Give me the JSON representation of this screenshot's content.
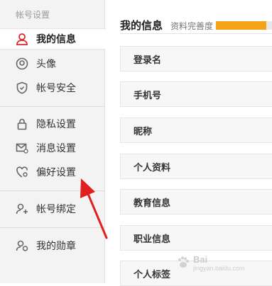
{
  "sidebar": {
    "section_title": "帐号设置",
    "items": [
      {
        "label": "我的信息",
        "icon": "user-icon",
        "active": true
      },
      {
        "label": "头像",
        "icon": "face-icon"
      },
      {
        "label": "帐号安全",
        "icon": "shield-icon"
      },
      {
        "label": "隐私设置",
        "icon": "lock-icon"
      },
      {
        "label": "消息设置",
        "icon": "mail-icon"
      },
      {
        "label": "偏好设置",
        "icon": "heart-gear-icon"
      },
      {
        "label": "帐号绑定",
        "icon": "user-link-icon"
      },
      {
        "label": "我的勋章",
        "icon": "medal-user-icon"
      }
    ]
  },
  "main": {
    "title": "我的信息",
    "completeness_label": "资料完善度",
    "completeness_fraction": 0.9,
    "rows": [
      {
        "label": "登录名"
      },
      {
        "label": "手机号"
      },
      {
        "label": "昵称"
      },
      {
        "label": "个人资料"
      },
      {
        "label": "教育信息"
      },
      {
        "label": "职业信息"
      },
      {
        "label": "个人标签"
      }
    ]
  },
  "colors": {
    "accent_red": "#e0262b",
    "progress_fill": "#f2a416",
    "sidebar_bg": "#f3f3f3",
    "annotation_arrow": "#e02020"
  },
  "watermark": {
    "brand": "Bai",
    "sub": "jingyan.baidu.com"
  }
}
